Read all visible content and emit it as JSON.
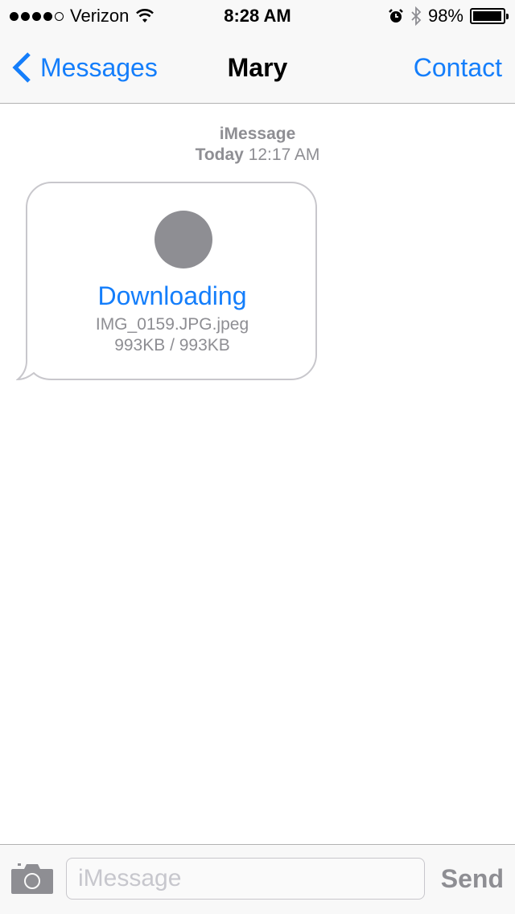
{
  "status_bar": {
    "carrier": "Verizon",
    "signal_bars_filled": 4,
    "signal_bars_total": 5,
    "time": "8:28 AM",
    "battery_percent": "98%",
    "icons": [
      "signal-dots-icon",
      "wifi-icon",
      "alarm-icon",
      "bluetooth-icon",
      "battery-icon"
    ]
  },
  "nav": {
    "back_label": "Messages",
    "title": "Mary",
    "contact_label": "Contact"
  },
  "conversation": {
    "service": "iMessage",
    "date_bold": "Today",
    "time": "12:17 AM",
    "messages": [
      {
        "direction": "incoming",
        "type": "attachment",
        "status": "Downloading",
        "filename": "IMG_0159.JPG.jpeg",
        "progress_text": "993KB / 993KB"
      }
    ]
  },
  "input_bar": {
    "placeholder": "iMessage",
    "send_label": "Send"
  },
  "colors": {
    "accent": "#147efb",
    "secondary_text": "#8e8e93",
    "bar_background": "#f8f8f8"
  }
}
